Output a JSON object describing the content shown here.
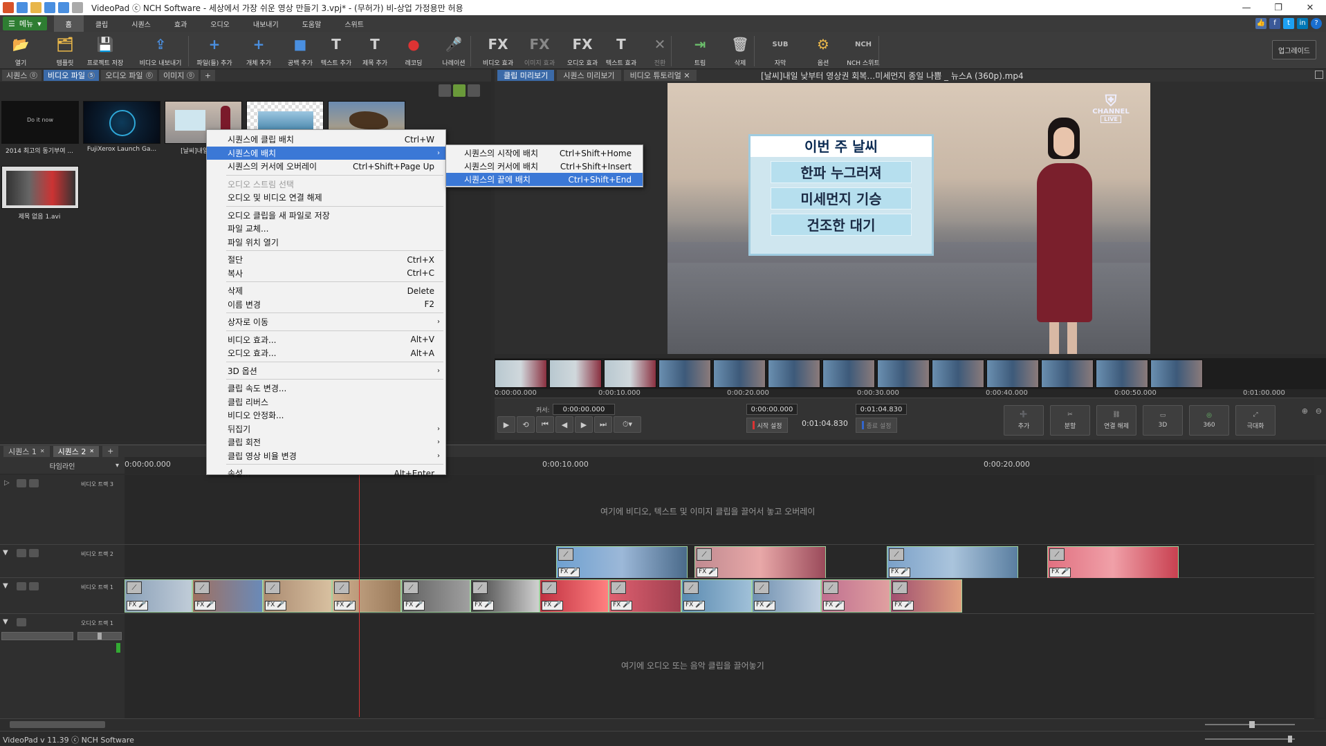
{
  "window": {
    "title": "VideoPad ⓒ NCH Software - 세상에서 가장 쉬운 영상 만들기 3.vpj* - (무허가) 비-상업 가정용만 허용",
    "minimize": "—",
    "restore": "❐",
    "close": "✕"
  },
  "menubar": {
    "menu_button": "메뉴",
    "tabs": [
      "홈",
      "클립",
      "시퀀스",
      "효과",
      "오디오",
      "내보내기",
      "도움말",
      "스위트"
    ],
    "active_tab": "홈"
  },
  "toolbar": {
    "items": [
      {
        "label": "열기",
        "icon": "folder-open-icon",
        "color": "#e8b64a"
      },
      {
        "label": "템플릿",
        "icon": "template-icon",
        "color": "#e8b64a"
      },
      {
        "label": "프로젝트 저장",
        "icon": "save-icon",
        "color": "#4a8fe0"
      },
      {
        "label": "비디오 내보내기",
        "icon": "export-icon",
        "color": "#4a8fe0"
      },
      {
        "label": "파일(들) 추가",
        "icon": "add-file-icon",
        "color": "#4a8fe0"
      },
      {
        "label": "개체 추가",
        "icon": "add-object-icon",
        "color": "#4a8fe0"
      },
      {
        "label": "공백 추가",
        "icon": "add-blank-icon",
        "color": "#4a8fe0"
      },
      {
        "label": "텍스트 추가",
        "icon": "add-text-icon",
        "color": "#cfcfcf"
      },
      {
        "label": "제목 추가",
        "icon": "add-title-icon",
        "color": "#cfcfcf"
      },
      {
        "label": "레코딩",
        "icon": "record-icon",
        "color": "#d33"
      },
      {
        "label": "나레이션",
        "icon": "microphone-icon",
        "color": "#bbb"
      },
      {
        "label": "비디오 효과",
        "icon": "video-effect-icon",
        "color": "#cfcfcf"
      },
      {
        "label": "이미지 효과",
        "icon": "image-effect-icon",
        "color": "#888",
        "disabled": true
      },
      {
        "label": "오디오 효과",
        "icon": "audio-effect-icon",
        "color": "#cfcfcf"
      },
      {
        "label": "텍스트 효과",
        "icon": "text-effect-icon",
        "color": "#cfcfcf"
      },
      {
        "label": "전환",
        "icon": "transition-icon",
        "color": "#888",
        "disabled": true
      },
      {
        "label": "트림",
        "icon": "trim-icon",
        "color": "#6cbf6c"
      },
      {
        "label": "삭제",
        "icon": "trash-icon",
        "color": "#bbb"
      },
      {
        "label": "자막",
        "icon": "subtitle-icon",
        "color": "#bbb"
      },
      {
        "label": "옵션",
        "icon": "options-icon",
        "color": "#e8b64a"
      },
      {
        "label": "NCH 스위트",
        "icon": "nch-suite-icon",
        "color": "#bbb"
      }
    ],
    "upgrade": "업그레이드"
  },
  "media_tabs": [
    {
      "label": "시퀀스",
      "count": "0",
      "active": false
    },
    {
      "label": "비디오 파일",
      "count": "5",
      "active": true
    },
    {
      "label": "오디오 파일",
      "count": "0",
      "active": false
    },
    {
      "label": "이미지",
      "count": "0",
      "active": false
    },
    {
      "label": "+",
      "count": "",
      "active": false
    }
  ],
  "media_files": [
    {
      "caption": "2014 최고의 동기부여 ..."
    },
    {
      "caption": "FujiXerox Launch Ga..."
    },
    {
      "caption": "[날씨]내일 낮..."
    },
    {
      "caption": ""
    },
    {
      "caption": ""
    },
    {
      "caption": "제목 없음 1.avi"
    }
  ],
  "context_menu": {
    "items": [
      {
        "label": "시퀀스에 클립 배치",
        "shortcut": "Ctrl+W"
      },
      {
        "label": "시퀀스에 배치",
        "shortcut": "",
        "submenu": true,
        "highlight": true
      },
      {
        "label": "시퀀스의 커서에 오버레이",
        "shortcut": "Ctrl+Shift+Page Up"
      },
      {
        "sep": true
      },
      {
        "label": "오디오 스트림 선택",
        "shortcut": "",
        "disabled": true
      },
      {
        "label": "오디오 및 비디오 연결 해제",
        "shortcut": ""
      },
      {
        "sep": true
      },
      {
        "label": "오디오 클립을 새 파일로 저장",
        "shortcut": ""
      },
      {
        "label": "파일 교체...",
        "shortcut": ""
      },
      {
        "label": "파일 위치 열기",
        "shortcut": ""
      },
      {
        "sep": true
      },
      {
        "label": "절단",
        "shortcut": "Ctrl+X"
      },
      {
        "label": "복사",
        "shortcut": "Ctrl+C"
      },
      {
        "sep": true
      },
      {
        "label": "삭제",
        "shortcut": "Delete"
      },
      {
        "label": "이름 변경",
        "shortcut": "F2"
      },
      {
        "sep": true
      },
      {
        "label": "상자로 이동",
        "shortcut": "",
        "submenu": true
      },
      {
        "sep": true
      },
      {
        "label": "비디오 효과...",
        "shortcut": "Alt+V"
      },
      {
        "label": "오디오 효과...",
        "shortcut": "Alt+A"
      },
      {
        "sep": true
      },
      {
        "label": "3D 옵션",
        "shortcut": "",
        "submenu": true
      },
      {
        "sep": true
      },
      {
        "label": "클립 속도 변경...",
        "shortcut": ""
      },
      {
        "label": "클립 리버스",
        "shortcut": ""
      },
      {
        "label": "비디오 안정화...",
        "shortcut": ""
      },
      {
        "label": "뒤집기",
        "shortcut": "",
        "submenu": true
      },
      {
        "label": "클립 회전",
        "shortcut": "",
        "submenu": true
      },
      {
        "label": "클립 영상 비율 변경",
        "shortcut": "",
        "submenu": true
      },
      {
        "sep": true
      },
      {
        "label": "속성...",
        "shortcut": "Alt+Enter"
      }
    ]
  },
  "submenu": {
    "items": [
      {
        "label": "시퀀스의 시작에 배치",
        "shortcut": "Ctrl+Shift+Home"
      },
      {
        "label": "시퀀스의 커서에 배치",
        "shortcut": "Ctrl+Shift+Insert"
      },
      {
        "label": "시퀀스의 끝에 배치",
        "shortcut": "Ctrl+Shift+End",
        "highlight": true
      }
    ]
  },
  "preview": {
    "tabs": [
      {
        "label": "클립 미리보기",
        "active": true
      },
      {
        "label": "시퀀스 미리보기",
        "active": false
      },
      {
        "label": "비디오 튜토리얼 ✕",
        "active": false
      }
    ],
    "file_title": "[날씨]내일 낮부터 영상권 회복…미세먼지 종일 나쁨 _ 뉴스A (360p).mp4",
    "board_title": "이번 주 날씨",
    "board_rows": [
      "한파 누그러져",
      "미세먼지 기승",
      "건조한 대기"
    ],
    "logo": "CHANNEL",
    "logo_sub": "LIVE",
    "ruler_times": [
      "0:00:00.000",
      "0:00:10.000",
      "0:00:20.000",
      "0:00:30.000",
      "0:00:40.000",
      "0:00:50.000",
      "0:01:00.000"
    ],
    "cursor_label": "커서:",
    "cursor_time": "0:00:00.000",
    "start_time": "0:00:00.000",
    "duration": "0:01:04.830",
    "end_time": "0:01:04.830",
    "set_start": "시작 설정",
    "set_end": "종료 설정",
    "controls": [
      "추가",
      "분할",
      "연결 해제",
      "3D",
      "360",
      "극대화"
    ]
  },
  "timeline": {
    "tabs": [
      {
        "label": "시퀀스 1",
        "active": false
      },
      {
        "label": "시퀀스 2",
        "active": true
      },
      {
        "label": "+",
        "active": false
      }
    ],
    "header_label": "타임라인",
    "ruler": [
      "0:00:00.000",
      "0:00:10.000",
      "0:00:20.000"
    ],
    "tracks": [
      {
        "name": "비디오 트랙 3",
        "hint": "여기에 비디오, 텍스트 및 이미지 클립을 끌어서 놓고 오버레이"
      },
      {
        "name": "비디오 트랙 2",
        "hint": ""
      },
      {
        "name": "비디오 트랙 1",
        "hint": ""
      },
      {
        "name": "오디오 트랙 1",
        "hint": "여기에 오디오 또는 음악 클립을 끌어놓기"
      }
    ]
  },
  "status": {
    "text": "VideoPad v 11.39 ⓒ NCH Software"
  }
}
